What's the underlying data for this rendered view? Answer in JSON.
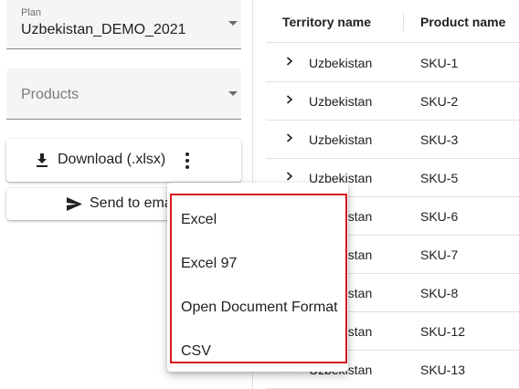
{
  "plan_field": {
    "label": "Plan",
    "value": "Uzbekistan_DEMO_2021"
  },
  "products_field": {
    "placeholder": "Products"
  },
  "download_button": {
    "label": "Download (.xlsx)",
    "icon": "download-icon",
    "more_icon": "more-vert-icon"
  },
  "send_button": {
    "label": "Send to ema",
    "icon": "send-icon"
  },
  "table": {
    "columns": [
      "Territory name",
      "Product name"
    ],
    "rows": [
      {
        "territory": "Uzbekistan",
        "product": "SKU-1"
      },
      {
        "territory": "Uzbekistan",
        "product": "SKU-2"
      },
      {
        "territory": "Uzbekistan",
        "product": "SKU-3"
      },
      {
        "territory": "Uzbekistan",
        "product": "SKU-5"
      },
      {
        "territory": "Uzbekistan",
        "product": "SKU-6"
      },
      {
        "territory": "Uzbekistan",
        "product": "SKU-7"
      },
      {
        "territory": "Uzbekistan",
        "product": "SKU-8"
      },
      {
        "territory": "Uzbekistan",
        "product": "SKU-12"
      },
      {
        "territory": "Uzbekistan",
        "product": "SKU-13"
      }
    ]
  },
  "export_menu": {
    "items": [
      "Excel",
      "Excel 97",
      "Open Document Format",
      "CSV"
    ],
    "highlight_color": "#d71920"
  }
}
